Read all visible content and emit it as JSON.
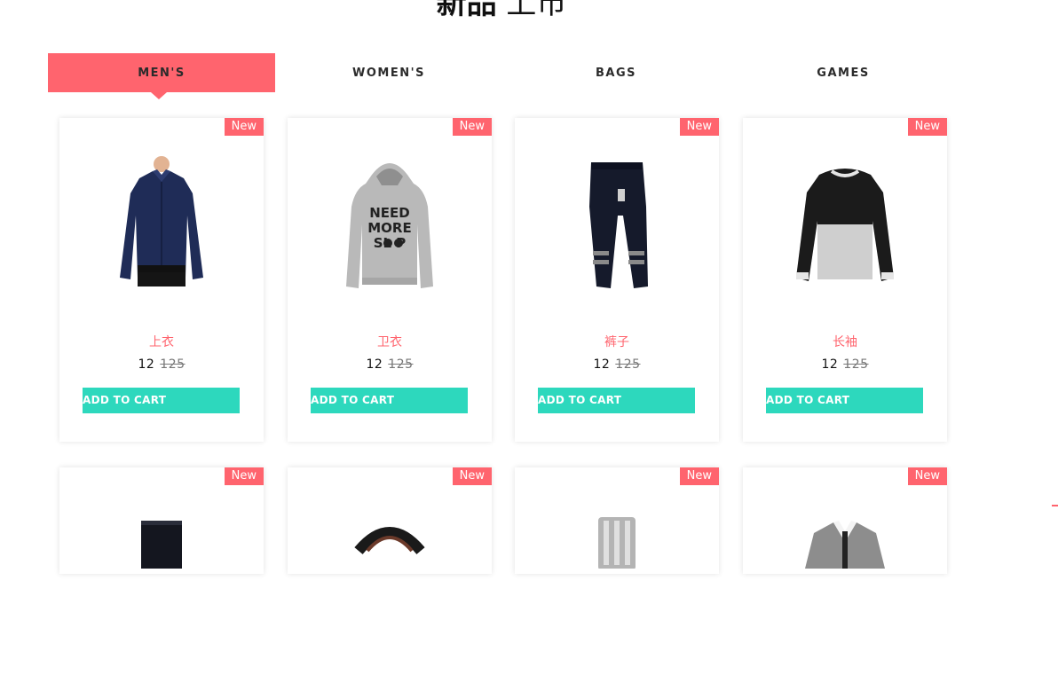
{
  "section": {
    "title_bold": "新品",
    "title_light": "上市"
  },
  "tabs": [
    {
      "label": "MEN'S",
      "active": true
    },
    {
      "label": "WOMEN'S",
      "active": false
    },
    {
      "label": "BAGS",
      "active": false
    },
    {
      "label": "GAMES",
      "active": false
    }
  ],
  "products": [
    {
      "badge": "New",
      "name": "上衣",
      "price": "12",
      "old_price": "125",
      "button": "ADD TO CART",
      "image": "navy-dress-shirt"
    },
    {
      "badge": "New",
      "name": "卫衣",
      "price": "12",
      "old_price": "125",
      "button": "ADD TO CART",
      "image": "grey-hoodie"
    },
    {
      "badge": "New",
      "name": "裤子",
      "price": "12",
      "old_price": "125",
      "button": "ADD TO CART",
      "image": "track-pants"
    },
    {
      "badge": "New",
      "name": "长袖",
      "price": "12",
      "old_price": "125",
      "button": "ADD TO CART",
      "image": "raglan-long-sleeve"
    },
    {
      "badge": "New",
      "image": "jeans"
    },
    {
      "badge": "New",
      "image": "leather-belt"
    },
    {
      "badge": "New",
      "image": "steel-watch"
    },
    {
      "badge": "New",
      "image": "grey-blazer"
    }
  ],
  "colors": {
    "accent": "#ff646e",
    "cart_button": "#2dd8bd"
  }
}
